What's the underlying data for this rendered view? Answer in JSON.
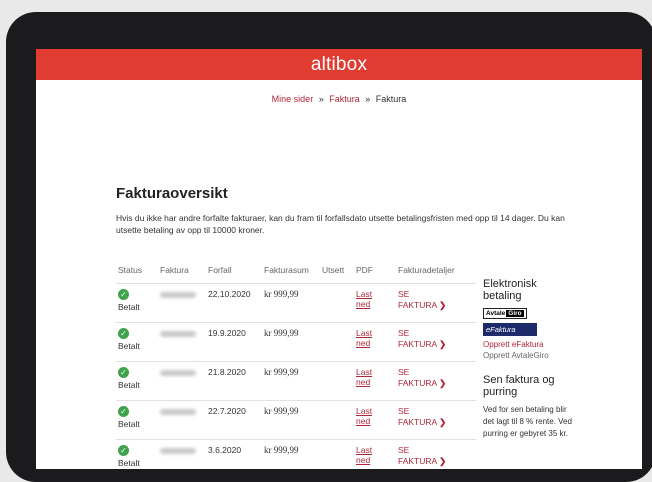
{
  "header": {
    "brand": "altibox"
  },
  "breadcrumb": {
    "items": [
      "Mine sider",
      "Faktura",
      "Faktura"
    ],
    "separator": "»"
  },
  "page": {
    "title": "Fakturaoversikt",
    "intro": "Hvis du ikke har andre forfalte fakturaer, kan du fram til forfallsdato utsette betalingsfristen med opp til 14 dager. Du kan utsette betaling av opp til 10000 kroner."
  },
  "table": {
    "headers": [
      "Status",
      "Faktura",
      "Forfall",
      "Fakturasum",
      "Utsett",
      "PDF",
      "Fakturadetaljer"
    ],
    "rows": [
      {
        "status": "Betalt",
        "due": "22.10.2020",
        "amount": "kr 999,99",
        "pdf": [
          "Last",
          "ned"
        ],
        "details": [
          "SE",
          "FAKTURA"
        ]
      },
      {
        "status": "Betalt",
        "due": "19.9.2020",
        "amount": "kr 999,99",
        "pdf": [
          "Last",
          "ned"
        ],
        "details": [
          "SE",
          "FAKTURA"
        ]
      },
      {
        "status": "Betalt",
        "due": "21.8.2020",
        "amount": "kr 999,99",
        "pdf": [
          "Last",
          "ned"
        ],
        "details": [
          "SE",
          "FAKTURA"
        ]
      },
      {
        "status": "Betalt",
        "due": "22.7.2020",
        "amount": "kr 999,99",
        "pdf": [
          "Last",
          "ned"
        ],
        "details": [
          "SE",
          "FAKTURA"
        ]
      },
      {
        "status": "Betalt",
        "due": "3.6.2020",
        "amount": "kr 999,99",
        "pdf": [
          "Last",
          "ned"
        ],
        "details": [
          "SE",
          "FAKTURA"
        ]
      }
    ]
  },
  "sidebar": {
    "efaktura_heading": "Elektronisk betaling",
    "avtalegiro_badge": [
      "Avtale",
      "Giro"
    ],
    "efaktura_badge": "eFaktura",
    "link_efaktura": "Opprett eFaktura",
    "link_avtalegiro": "Opprett AvtaleGiro",
    "late_heading": "Sen faktura og purring",
    "late_text": "Ved for sen betaling blir det lagt til 8 % rente. Ved purring er gebyret 35 kr."
  },
  "colors": {
    "brand_red": "#e03c31",
    "link": "#b0273a",
    "paid_green": "#3fa34d"
  }
}
